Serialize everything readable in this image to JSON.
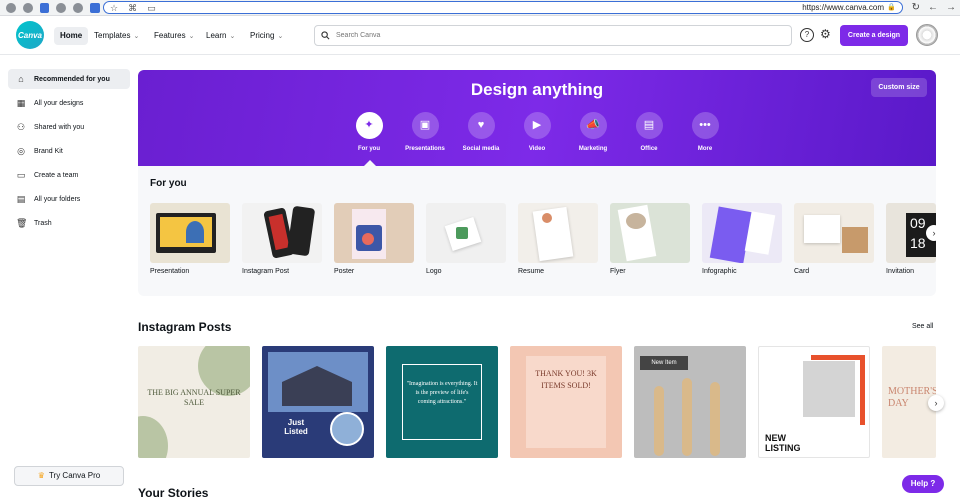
{
  "browser": {
    "url": "https://www.canva.com"
  },
  "nav": {
    "logo_text": "Canva",
    "home": "Home",
    "templates": "Templates",
    "features": "Features",
    "learn": "Learn",
    "pricing": "Pricing",
    "search_placeholder": "Search Canva",
    "help_icon": "?",
    "create_button": "Create a design"
  },
  "sidebar": {
    "items": [
      {
        "label": "Recommended for you",
        "icon": "home-icon"
      },
      {
        "label": "All your designs",
        "icon": "grid-icon"
      },
      {
        "label": "Shared with you",
        "icon": "people-icon"
      },
      {
        "label": "Brand Kit",
        "icon": "brand-icon"
      },
      {
        "label": "Create a team",
        "icon": "team-icon"
      },
      {
        "label": "All your folders",
        "icon": "folder-icon"
      },
      {
        "label": "Trash",
        "icon": "trash-icon"
      }
    ],
    "try_pro": "Try Canva Pro"
  },
  "hero": {
    "title": "Design anything",
    "custom_size": "Custom size",
    "categories": [
      {
        "label": "For you",
        "icon": "sparkle-icon"
      },
      {
        "label": "Presentations",
        "icon": "presentation-icon"
      },
      {
        "label": "Social media",
        "icon": "heart-icon"
      },
      {
        "label": "Video",
        "icon": "video-icon"
      },
      {
        "label": "Marketing",
        "icon": "megaphone-icon"
      },
      {
        "label": "Office",
        "icon": "briefcase-icon"
      },
      {
        "label": "More",
        "icon": "more-icon"
      }
    ]
  },
  "for_you": {
    "heading": "For you",
    "tiles": [
      "Presentation",
      "Instagram Post",
      "Poster",
      "Logo",
      "Resume",
      "Flyer",
      "Infographic",
      "Card",
      "Invitation"
    ]
  },
  "instagram": {
    "heading": "Instagram Posts",
    "see_all": "See all",
    "posts": [
      {
        "text": "THE BIG ANNUAL SUPER SALE"
      },
      {
        "text": "Just Listed"
      },
      {
        "text": "\"Imagination is everything. It is the preview of life's coming attractions.\""
      },
      {
        "text": "THANK YOU! 3K ITEMS SOLD!"
      },
      {
        "text": "New Item"
      },
      {
        "text": "NEW LISTING"
      },
      {
        "text": "MOTHER'S DAY"
      }
    ]
  },
  "stories": {
    "heading": "Your Stories"
  },
  "help_button": "Help ?"
}
